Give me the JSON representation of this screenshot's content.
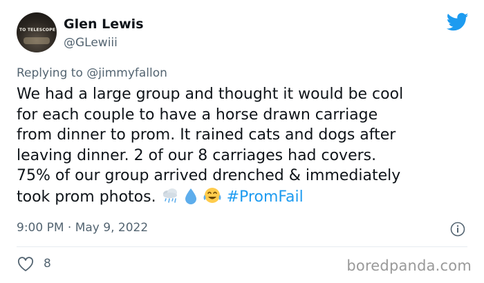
{
  "author": {
    "display_name": "Glen Lewis",
    "handle": "@GLewiii",
    "avatar_sign_text": "TO TELESCOPE"
  },
  "reply": {
    "prefix": "Replying to",
    "target": "@jimmyfallon"
  },
  "tweet": {
    "lines": [
      "We had a large group and thought it would be cool",
      "for each couple to have a horse drawn carriage",
      "from dinner to prom. It rained cats and dogs after",
      "leaving dinner. 2 of our 8 carriages had covers.",
      "75% of our group arrived drenched & immediately"
    ],
    "last_line_text": "took prom photos.",
    "emojis": [
      "cloud-with-rain-icon",
      "droplet-icon",
      "tears-of-joy-icon"
    ],
    "hashtag": "#PromFail"
  },
  "meta": {
    "time": "9:00 PM",
    "separator": "·",
    "date": "May 9, 2022"
  },
  "engagement": {
    "likes": "8"
  },
  "watermark": "boredpanda.com",
  "colors": {
    "twitter_blue": "#1d9bf0",
    "secondary_text": "#536471",
    "primary_text": "#0f1419",
    "watermark": "#999999"
  }
}
